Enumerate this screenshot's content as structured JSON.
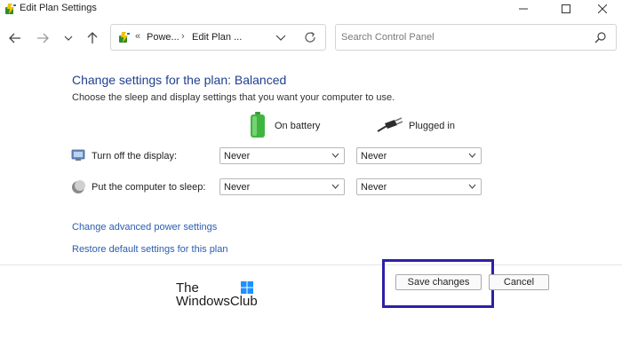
{
  "window": {
    "title": "Edit Plan Settings"
  },
  "address_bar": {
    "chevrons": "«",
    "crumb1": "Powe...",
    "separator": "›",
    "crumb2": "Edit Plan ..."
  },
  "search": {
    "placeholder": "Search Control Panel"
  },
  "main": {
    "heading": "Change settings for the plan: Balanced",
    "subheading": "Choose the sleep and display settings that you want your computer to use.",
    "columns": {
      "on_battery": "On battery",
      "plugged_in": "Plugged in"
    },
    "settings": [
      {
        "label": "Turn off the display:",
        "on_battery": "Never",
        "plugged_in": "Never"
      },
      {
        "label": "Put the computer to sleep:",
        "on_battery": "Never",
        "plugged_in": "Never"
      }
    ],
    "links": {
      "advanced": "Change advanced power settings",
      "restore": "Restore default settings for this plan"
    }
  },
  "footer": {
    "save_label": "Save changes",
    "cancel_label": "Cancel",
    "highlight_color": "#2b21a8"
  },
  "watermark": {
    "line1": "The",
    "line2": "WindowsClub"
  },
  "colors": {
    "heading": "#1f3f8f",
    "link": "#2a5db0"
  }
}
